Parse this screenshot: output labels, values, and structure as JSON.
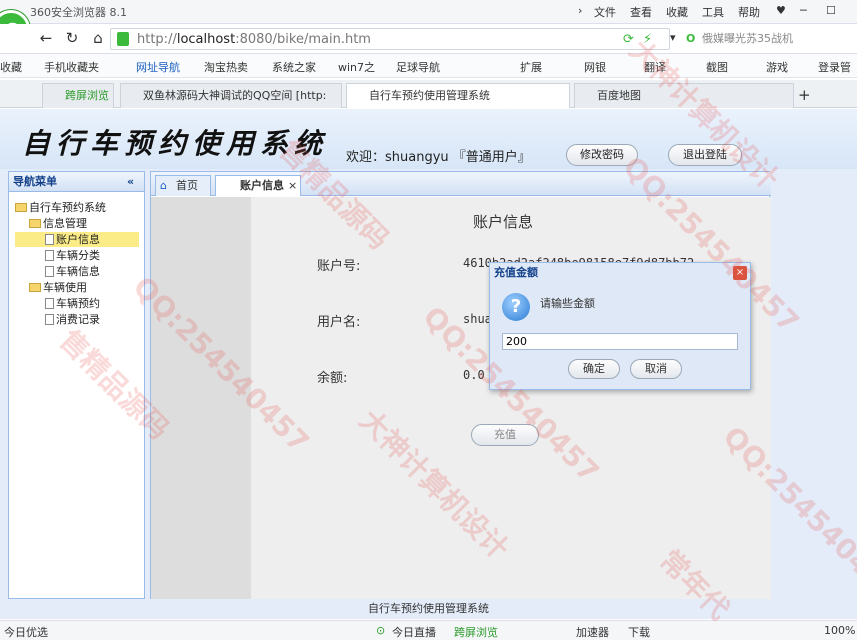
{
  "browser": {
    "title": "360安全浏览器 8.1",
    "menu": [
      "文件",
      "查看",
      "收藏",
      "工具",
      "帮助"
    ],
    "url_prefix": "http://",
    "url_host": "localhost",
    "url_rest": ":8080/bike/main.htm",
    "search_placeholder": "俄媒曝光苏35战机",
    "bookmarks": [
      "收藏",
      "手机收藏夹",
      "网址导航",
      "淘宝热卖",
      "系统之家",
      "win7之",
      "足球导航",
      "扩展",
      "网银",
      "翻译",
      "截图",
      "游戏",
      "登录管"
    ],
    "tabs": [
      "跨屏浏览",
      "双鱼林源码大神调试的QQ空间 [http:",
      "自行车预约使用管理系统",
      "百度地图"
    ],
    "status": {
      "left": "今日优选",
      "items": [
        "今日直播",
        "跨屏浏览",
        "加速器",
        "下载"
      ],
      "zoom": "100%"
    }
  },
  "app": {
    "title": "自行车预约使用系统",
    "welcome": "欢迎：shuangyu 『普通用户』",
    "change_pwd": "修改密码",
    "logout": "退出登陆",
    "nav_title": "导航菜单",
    "tree": {
      "root": "自行车预约系统",
      "groups": [
        {
          "label": "信息管理",
          "items": [
            "账户信息",
            "车辆分类",
            "车辆信息"
          ]
        },
        {
          "label": "车辆使用",
          "items": [
            "车辆预约",
            "消费记录"
          ]
        }
      ]
    },
    "tabs": {
      "home": "首页",
      "current": "账户信息"
    },
    "account": {
      "heading": "账户信息",
      "id_label": "账户号:",
      "id_value": "4610b2ad2af248be98158e7f9d87bb72",
      "name_label": "用户名:",
      "name_value": "shua",
      "balance_label": "余额:",
      "balance_value": "0.0",
      "recharge": "充值"
    },
    "footer": "自行车预约使用管理系统"
  },
  "dialog": {
    "title": "充值金额",
    "message": "请输些金额",
    "value": "200",
    "ok": "确定",
    "cancel": "取消"
  },
  "watermarks": [
    "QQ:254540457",
    "售精品源码",
    "大神计算机设计",
    "常年代"
  ]
}
